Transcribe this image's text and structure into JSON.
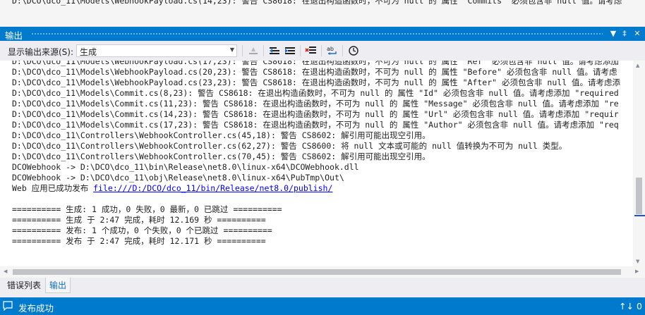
{
  "partial_top_line": "D:\\DCO\\dco_11\\Models\\WebhookPayload.cs(14,23): 警告 CS8618: 在退出构造函数时，不可为 null 的 属性 \"Commits\" 必须包含非 null 值。请考虑",
  "panel": {
    "title": "输出",
    "buttons": {
      "dropdown": "▼",
      "pin": "‡",
      "close": "✕"
    }
  },
  "toolbar": {
    "source_label": "显示输出来源(S):",
    "source_value": "生成",
    "tools": [
      "find-message-icon",
      "previous-message-icon",
      "next-message-icon",
      "clear-all-icon",
      "word-wrap-icon",
      "timestamp-icon"
    ]
  },
  "output_lines": [
    "D:\\DCO\\dco_11\\Models\\WebhookPayload.cs(17,23): 警告 CS8618: 在退出构造函数时，不可为 null 的 属性 \"Ref\" 必须包含非 null 值。请考虑添加",
    "D:\\DCO\\dco_11\\Models\\WebhookPayload.cs(20,23): 警告 CS8618: 在退出构造函数时，不可为 null 的 属性 \"Before\" 必须包含非 null 值。请考虑",
    "D:\\DCO\\dco_11\\Models\\WebhookPayload.cs(23,23): 警告 CS8618: 在退出构造函数时，不可为 null 的 属性 \"After\" 必须包含非 null 值。请考虑添",
    "D:\\DCO\\dco_11\\Models\\Commit.cs(8,23): 警告 CS8618: 在退出构造函数时，不可为 null 的 属性 \"Id\" 必须包含非 null 值。请考虑添加 \"required",
    "D:\\DCO\\dco_11\\Models\\Commit.cs(11,23): 警告 CS8618: 在退出构造函数时，不可为 null 的 属性 \"Message\" 必须包含非 null 值。请考虑添加 \"re",
    "D:\\DCO\\dco_11\\Models\\Commit.cs(14,23): 警告 CS8618: 在退出构造函数时，不可为 null 的 属性 \"Url\" 必须包含非 null 值。请考虑添加 \"requir",
    "D:\\DCO\\dco_11\\Models\\Commit.cs(17,23): 警告 CS8618: 在退出构造函数时，不可为 null 的 属性 \"Author\" 必须包含非 null 值。请考虑添加 \"req",
    "D:\\DCO\\dco_11\\Controllers\\WebhookController.cs(45,18): 警告 CS8602: 解引用可能出现空引用。",
    "D:\\DCO\\dco_11\\Controllers\\WebhookController.cs(62,27): 警告 CS8600: 将 null 文本或可能的 null 值转换为不可为 null 类型。",
    "D:\\DCO\\dco_11\\Controllers\\WebhookController.cs(70,45): 警告 CS8602: 解引用可能出现空引用。",
    "DCOWebhook -> D:\\DCO\\dco_11\\bin\\Release\\net8.0\\linux-x64\\DCOWebhook.dll",
    "DCOWebhook -> D:\\DCO\\dco_11\\obj\\Release\\net8.0\\linux-x64\\PubTmp\\Out\\"
  ],
  "publish_line": {
    "prefix": "Web 应用已成功发布 ",
    "link": "file:///D:/DCO/dco_11/bin/Release/net8.0/publish/"
  },
  "summary_lines": [
    "========== 生成: 1 成功，0 失败，0 最新，0 已跳过 ==========",
    "========== 生成 于 2:47 完成，耗时 12.169 秒 ==========",
    "========== 发布: 1 个成功，0 个失败，0 个已跳过 ==========",
    "========== 发布 于 2:47 完成，耗时 12.171 秒 =========="
  ],
  "tabs": [
    {
      "label": "错误列表",
      "active": false
    },
    {
      "label": "输出",
      "active": true
    }
  ],
  "status_bar": {
    "message": "发布成功",
    "right_text": "↑↓ 0"
  },
  "colors": {
    "accent": "#007acc",
    "link": "#0000ff",
    "active_tab_text": "#0e70c0"
  }
}
